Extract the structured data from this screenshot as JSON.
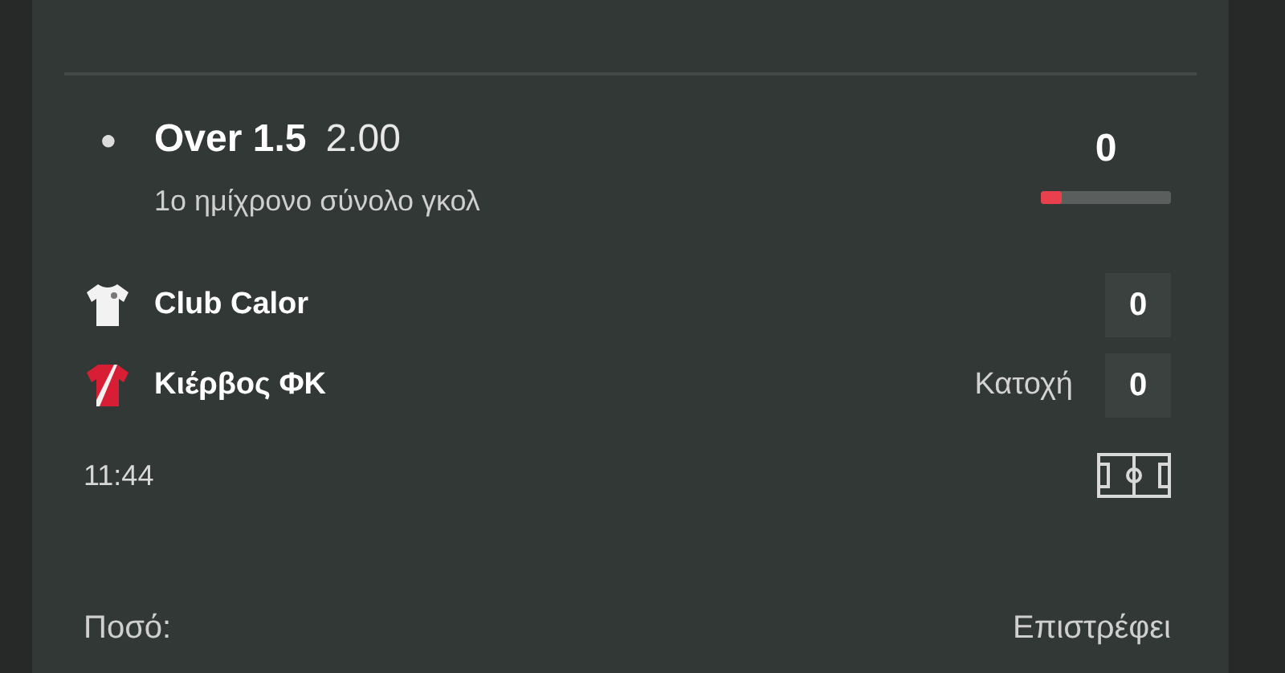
{
  "selection": {
    "bullet": "●",
    "market": "Over 1.5",
    "odds": "2.00",
    "description": "1ο ημίχρονο σύνολο γκολ",
    "count": "0",
    "level": 0.16
  },
  "teams": [
    {
      "name": "Club Calor",
      "kind": "plain",
      "score": "0"
    },
    {
      "name": "Κιέρβος ΦΚ",
      "kind": "sash",
      "score": "0",
      "stat_label": "Κατοχή"
    }
  ],
  "match_time": "11:44",
  "footer": {
    "stake_label": "Ποσό:",
    "returns_label": "Επιστρέφει"
  }
}
